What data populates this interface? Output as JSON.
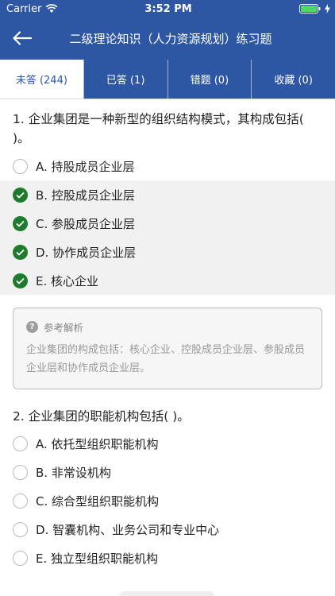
{
  "status": {
    "carrier": "Carrier",
    "time": "3:52 PM"
  },
  "nav": {
    "title": "二级理论知识（人力资源规划）练习题"
  },
  "tabs": [
    {
      "label": "未答 (244)"
    },
    {
      "label": "已答 (1)"
    },
    {
      "label": "错题 (0)"
    },
    {
      "label": "收藏 (0)"
    }
  ],
  "q1": {
    "text": "1. 企业集团是一种新型的组织结构模式，其构成包括(    )。",
    "options": [
      {
        "label": "A. 持股成员企业层",
        "selected": false
      },
      {
        "label": "B. 控股成员企业层",
        "selected": true
      },
      {
        "label": "C. 参股成员企业层",
        "selected": true
      },
      {
        "label": "D. 协作成员企业层",
        "selected": true
      },
      {
        "label": "E. 核心企业",
        "selected": true
      }
    ],
    "analysis": {
      "title": "参考解析",
      "text": "企业集团的构成包括：核心企业、控股成员企业层、参股成员企业层和协作成员企业层。"
    }
  },
  "q2": {
    "text": "2. 企业集团的职能机构包括(    )。",
    "options": [
      {
        "label": "A. 依托型组织职能机构"
      },
      {
        "label": "B. 非常设机构"
      },
      {
        "label": "C. 综合型组织职能机构"
      },
      {
        "label": "D. 智囊机构、业务公司和专业中心"
      },
      {
        "label": "E. 独立型组织职能机构"
      }
    ]
  },
  "colors": {
    "brand": "#2d57a4",
    "check": "#1e7a2c"
  }
}
